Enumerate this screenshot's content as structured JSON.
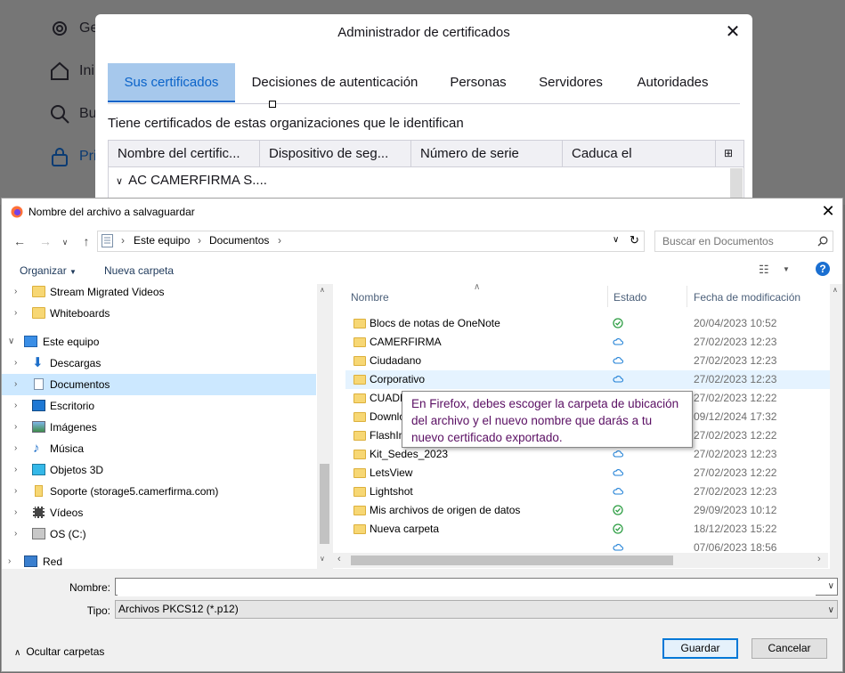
{
  "background_settings": {
    "nav": [
      {
        "label": "Ge",
        "icon": "gear-icon"
      },
      {
        "label": "Ini",
        "icon": "home-icon"
      },
      {
        "label": "Bu",
        "icon": "search-icon"
      },
      {
        "label": "Pri",
        "icon": "lock-icon"
      }
    ]
  },
  "cert_manager": {
    "title": "Administrador de certificados",
    "tabs": [
      "Sus certificados",
      "Decisiones de autenticación",
      "Personas",
      "Servidores",
      "Autoridades"
    ],
    "description": "Tiene certificados de estas organizaciones que le identifican",
    "columns": [
      "Nombre del certific...",
      "Dispositivo de seg...",
      "Número de serie",
      "Caduca el"
    ],
    "rows": [
      "AC CAMERFIRMA S...."
    ]
  },
  "save_dialog": {
    "title": "Nombre del archivo a salvaguardar",
    "breadcrumbs": [
      "Este equipo",
      "Documentos"
    ],
    "search_placeholder": "Buscar en Documentos",
    "toolbar": {
      "organize": "Organizar",
      "new_folder": "Nueva carpeta"
    },
    "nav_tree": [
      {
        "label": "Stream Migrated Videos",
        "icon": "folder-icon"
      },
      {
        "label": "Whiteboards",
        "icon": "folder-icon"
      },
      {
        "label": "Este equipo",
        "icon": "computer-icon"
      },
      {
        "label": "Descargas",
        "icon": "download-icon"
      },
      {
        "label": "Documentos",
        "icon": "document-icon"
      },
      {
        "label": "Escritorio",
        "icon": "desktop-icon"
      },
      {
        "label": "Imágenes",
        "icon": "pictures-icon"
      },
      {
        "label": "Música",
        "icon": "music-icon"
      },
      {
        "label": "Objetos 3D",
        "icon": "cube-icon"
      },
      {
        "label": "Soporte (storage5.camerfirma.com)",
        "icon": "network-drive-icon"
      },
      {
        "label": "Vídeos",
        "icon": "video-icon"
      },
      {
        "label": "OS (C:)",
        "icon": "drive-icon"
      },
      {
        "label": "Red",
        "icon": "network-icon"
      }
    ],
    "columns": {
      "name": "Nombre",
      "status": "Estado",
      "modified": "Fecha de modificación"
    },
    "files": [
      {
        "name": "Blocs de notas de OneNote",
        "status": "synced",
        "date": "20/04/2023 10:52"
      },
      {
        "name": "CAMERFIRMA",
        "status": "cloud",
        "date": "27/02/2023 12:23"
      },
      {
        "name": "Ciudadano",
        "status": "cloud",
        "date": "27/02/2023 12:23"
      },
      {
        "name": "Corporativo",
        "status": "cloud",
        "date": "27/02/2023 12:23"
      },
      {
        "name": "CUADR",
        "status": "cloud",
        "date": "27/02/2023 12:22"
      },
      {
        "name": "Downlo",
        "status": "cloud",
        "date": "09/12/2024 17:32"
      },
      {
        "name": "FlashIn",
        "status": "cloud",
        "date": "27/02/2023 12:22"
      },
      {
        "name": "Kit_Sedes_2023",
        "status": "cloud",
        "date": "27/02/2023 12:23"
      },
      {
        "name": "LetsView",
        "status": "cloud",
        "date": "27/02/2023 12:22"
      },
      {
        "name": "Lightshot",
        "status": "cloud",
        "date": "27/02/2023 12:23"
      },
      {
        "name": "Mis archivos de origen de datos",
        "status": "synced",
        "date": "29/09/2023 10:12"
      },
      {
        "name": "Nueva carpeta",
        "status": "synced",
        "date": "18/12/2023 15:22"
      },
      {
        "name": "",
        "status": "cloud",
        "date": "07/06/2023 18:56"
      }
    ],
    "filename_label": "Nombre:",
    "filename_value": "",
    "type_label": "Tipo:",
    "type_value": "Archivos PKCS12 (*.p12)",
    "hide_folders": "Ocultar carpetas",
    "save_button": "Guardar",
    "cancel_button": "Cancelar"
  },
  "tooltip": "En Firefox, debes escoger la carpeta de ubicación del archivo y el nuevo nombre que darás a tu nuevo certificado exportado.",
  "colors": {
    "accent": "#0078d7",
    "tab_active_bg": "#a6c8ec",
    "tooltip_text": "#5a0f63",
    "synced_green": "#2e9e44",
    "cloud_blue": "#1e7fd6"
  }
}
